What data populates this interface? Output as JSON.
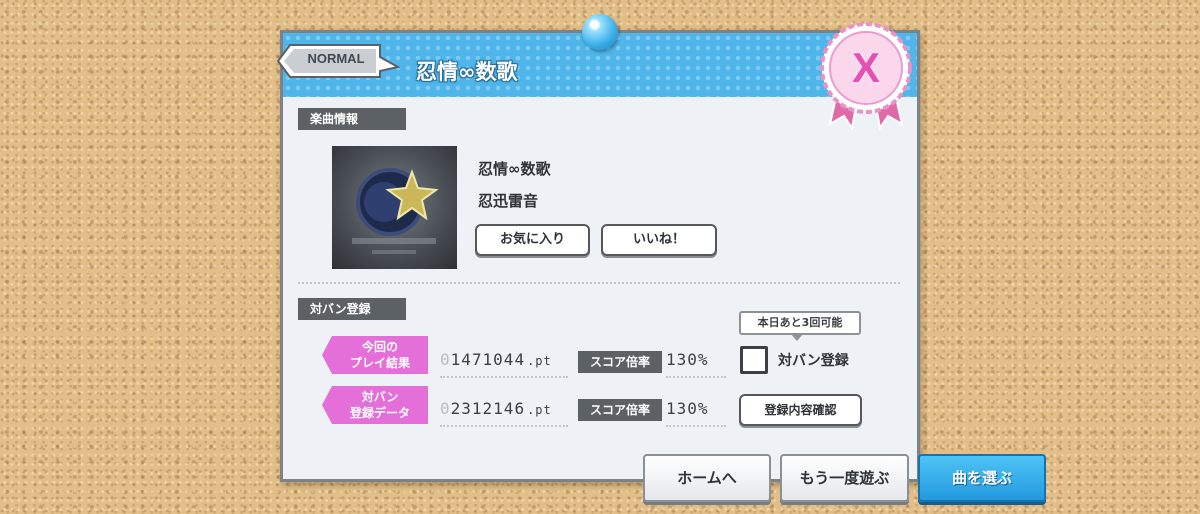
{
  "header": {
    "difficulty": "NORMAL",
    "song_title": "忍情∞数歌",
    "rank": "X"
  },
  "song_info": {
    "section_label": "楽曲情報",
    "title": "忍情∞数歌",
    "artist": "忍迅雷音",
    "favorite_label": "お気に入り",
    "like_label": "いいね！"
  },
  "battle": {
    "section_label": "対バン登録",
    "current_label": "今回の\nプレイ結果",
    "current_score_pad": "0",
    "current_score": "1471044",
    "registered_label": "対バン\n登録データ",
    "registered_score_pad": "0",
    "registered_score": "2312146",
    "score_unit": ".pt",
    "rate_label": "スコア倍率",
    "current_rate": "130%",
    "registered_rate": "130%",
    "remaining_tooltip": "本日あと3回可能",
    "register_label": "対バン登録",
    "confirm_label": "登録内容確認"
  },
  "footer": {
    "home_label": "ホームへ",
    "replay_label": "もう一度遊ぶ",
    "select_label": "曲を選ぶ"
  },
  "colors": {
    "header_blue": "#4eb6ea",
    "accent_pink": "#e56fd9",
    "primary_button": "#239ae0"
  }
}
